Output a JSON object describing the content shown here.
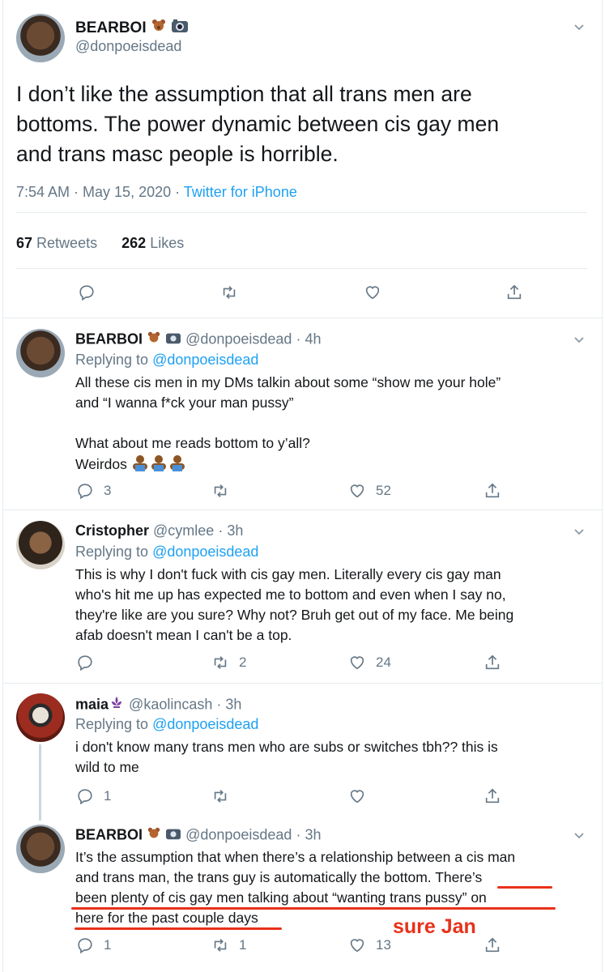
{
  "main_tweet": {
    "name": "BEARBOI",
    "handle": "@donpoeisdead",
    "text_line1": "I don’t like the assumption that all trans men are",
    "text_line2": "bottoms. The power dynamic between cis gay men",
    "text_line3": "and trans masc people is horrible.",
    "time": "7:54 AM · May 15, 2020 · ",
    "source": "Twitter for iPhone",
    "retweets_count": "67",
    "retweets_label": "Retweets",
    "likes_count": "262",
    "likes_label": "Likes"
  },
  "replies": [
    {
      "name": "BEARBOI",
      "handle_time": "@donpoeisdead · 4h",
      "replying_label": "Replying to ",
      "replying_handle": "@donpoeisdead",
      "lines": [
        "All these cis men in my DMs talkin about some “show me your hole”",
        "and “I wanna f*ck your man pussy”",
        "",
        "What about me reads bottom to y’all?",
        "Weirdos"
      ],
      "reply_count": "3",
      "retweet_count": "",
      "like_count": "52"
    },
    {
      "name": "Cristopher",
      "handle_time": "@cymlee · 3h",
      "replying_label": "Replying to ",
      "replying_handle": "@donpoeisdead",
      "lines": [
        "This is why I don't fuck with cis gay men. Literally every cis gay man",
        "who's hit me up has expected me to bottom and even when I say no,",
        "they're like are you sure? Why not? Bruh get out of my face. Me being",
        "afab doesn't mean I can't be a top."
      ],
      "reply_count": "",
      "retweet_count": "2",
      "like_count": "24"
    },
    {
      "name": "maia",
      "handle_time": "@kaolincash · 3h",
      "replying_label": "Replying to ",
      "replying_handle": "@donpoeisdead",
      "lines": [
        "i don't know many trans men who are subs or switches tbh?? this is",
        "wild to me"
      ],
      "reply_count": "1",
      "retweet_count": "",
      "like_count": ""
    },
    {
      "name": "BEARBOI",
      "handle_time": "@donpoeisdead · 3h",
      "lines": [
        "It’s the assumption that when there’s a relationship between a cis man",
        "and trans man, the trans guy is automatically the bottom. There’s",
        "been plenty of cis gay men talking about “wanting trans pussy” on",
        "here for the past couple days"
      ],
      "reply_count": "1",
      "retweet_count": "1",
      "like_count": "13"
    }
  ],
  "annotation": {
    "text": "sure Jan",
    "color": "#e8311a"
  },
  "colors": {
    "accent": "#1da1f2",
    "muted": "#657786"
  }
}
